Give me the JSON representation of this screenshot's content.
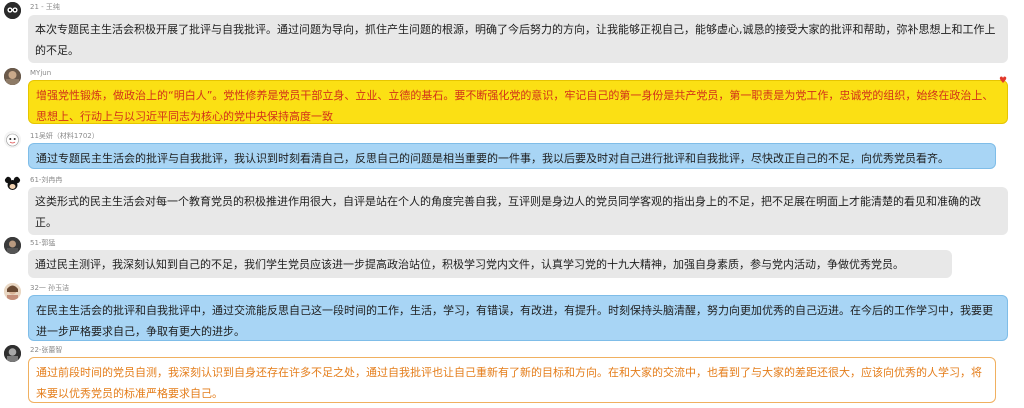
{
  "messages": [
    {
      "name": "21 - 王纯",
      "text": "本次专题民主生活会积极开展了批评与自我批评。通过问题为导向，抓住产生问题的根源，明确了今后努力的方向，让我能够正视自己，能够虚心,诚恳的接受大家的批评和帮助，弥补思想上和工作上的不足。",
      "style": "grey"
    },
    {
      "name": "MYjun",
      "text": "增强党性锻炼，做政治上的“明白人”。党性修养是党员干部立身、立业、立德的基石。要不断强化党的意识，牢记自己的第一身份是共产党员，第一职责是为党工作，忠诚党的组织，始终在政治上、思想上、行动上与以习近平同志为核心的党中央保持高度一致",
      "style": "yellow",
      "decoration": "heart-icon"
    },
    {
      "name": "11吴妍（材料1702）",
      "text": "通过专题民主生活会的批评与自我批评，我认识到时刻看清自己，反思自己的问题是相当重要的一件事，我以后要及时对自己进行批评和自我批评，尽快改正自己的不足，向优秀党员看齐。",
      "style": "blue"
    },
    {
      "name": "61-刘冉冉",
      "text": "这类形式的民主生活会对每一个教育党员的积极推进作用很大，自评是站在个人的角度完善自我，互评则是身边人的党员同学客观的指出身上的不足，把不足展在明面上才能清楚的看见和准确的改正。",
      "style": "grey"
    },
    {
      "name": "51-郭猛",
      "text": "通过民主测评，我深刻认知到自己的不足，我们学生党员应该进一步提高政治站位，积极学习党内文件，认真学习党的十九大精神，加强自身素质，参与党内活动，争做优秀党员。",
      "style": "grey"
    },
    {
      "name": "32一 孙玉洁",
      "text": "在民主生活会的批评和自我批评中，通过交流能反思自己这一段时间的工作，生活，学习，有错误，有改进，有提升。时刻保持头脑清醒，努力向更加优秀的自己迈进。在今后的工作学习中，我要更进一步严格要求自己，争取有更大的进步。",
      "style": "blue"
    },
    {
      "name": "22-张蕾智",
      "text": "通过前段时间的党员自测，我深刻认识到自身还存在许多不足之处，通过自我批评也让自己重新有了新的目标和方向。在和大家的交流中，也看到了与大家的差距还很大，应该向优秀的人学习，将来要以优秀党员的标准严格要求自己。",
      "style": "white"
    }
  ],
  "colors": {
    "grey_bubble": "#e8e8e8",
    "yellow_bubble": "#fbe014",
    "yellow_text": "#d2311a",
    "blue_bubble": "#a8d5f5",
    "white_bubble_text": "#e47d1a",
    "name_text": "#8a8a8a"
  }
}
